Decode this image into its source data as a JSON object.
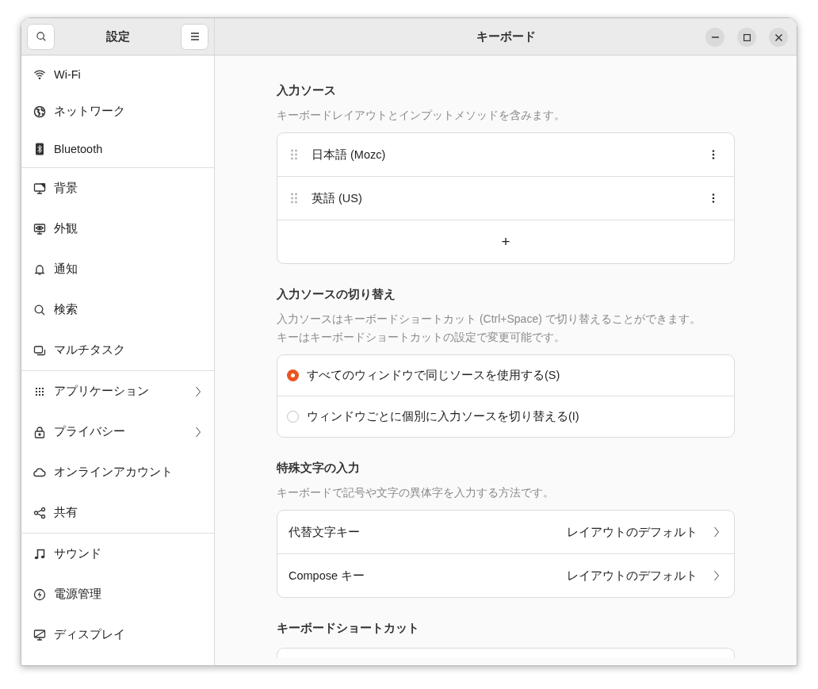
{
  "sidebar": {
    "title": "設定",
    "groups": [
      [
        {
          "label": "Wi-Fi",
          "submenu": false
        },
        {
          "label": "ネットワーク",
          "submenu": false
        },
        {
          "label": "Bluetooth",
          "submenu": false
        }
      ],
      [
        {
          "label": "背景",
          "submenu": false
        },
        {
          "label": "外観",
          "submenu": false
        },
        {
          "label": "通知",
          "submenu": false
        },
        {
          "label": "検索",
          "submenu": false
        },
        {
          "label": "マルチタスク",
          "submenu": false
        }
      ],
      [
        {
          "label": "アプリケーション",
          "submenu": true
        },
        {
          "label": "プライバシー",
          "submenu": true
        },
        {
          "label": "オンラインアカウント",
          "submenu": false
        },
        {
          "label": "共有",
          "submenu": false
        }
      ],
      [
        {
          "label": "サウンド",
          "submenu": false
        },
        {
          "label": "電源管理",
          "submenu": false
        },
        {
          "label": "ディスプレイ",
          "submenu": false
        }
      ]
    ]
  },
  "window": {
    "title": "キーボード"
  },
  "sections": [
    {
      "kind": "sources",
      "title": "入力ソース",
      "description": [
        "キーボードレイアウトとインプットメソッドを含みます。"
      ],
      "items": [
        {
          "label": "日本語 (Mozc)"
        },
        {
          "label": "英語 (US)"
        }
      ],
      "add": "+"
    },
    {
      "kind": "radios",
      "title": "入力ソースの切り替え",
      "description": [
        "入力ソースはキーボードショートカット (Ctrl+Space) で切り替えることができます。",
        "キーはキーボードショートカットの設定で変更可能です。"
      ],
      "items": [
        {
          "label": "すべてのウィンドウで同じソースを使用する(S)",
          "selected": true
        },
        {
          "label": "ウィンドウごとに個別に入力ソースを切り替える(I)",
          "selected": false
        }
      ]
    },
    {
      "kind": "links",
      "title": "特殊文字の入力",
      "description": [
        "キーボードで記号や文字の異体字を入力する方法です。"
      ],
      "items": [
        {
          "label": "代替文字キー",
          "value": "レイアウトのデフォルト"
        },
        {
          "label": "Compose キー",
          "value": "レイアウトのデフォルト"
        }
      ]
    },
    {
      "kind": "cut",
      "title": "キーボードショートカット"
    }
  ]
}
